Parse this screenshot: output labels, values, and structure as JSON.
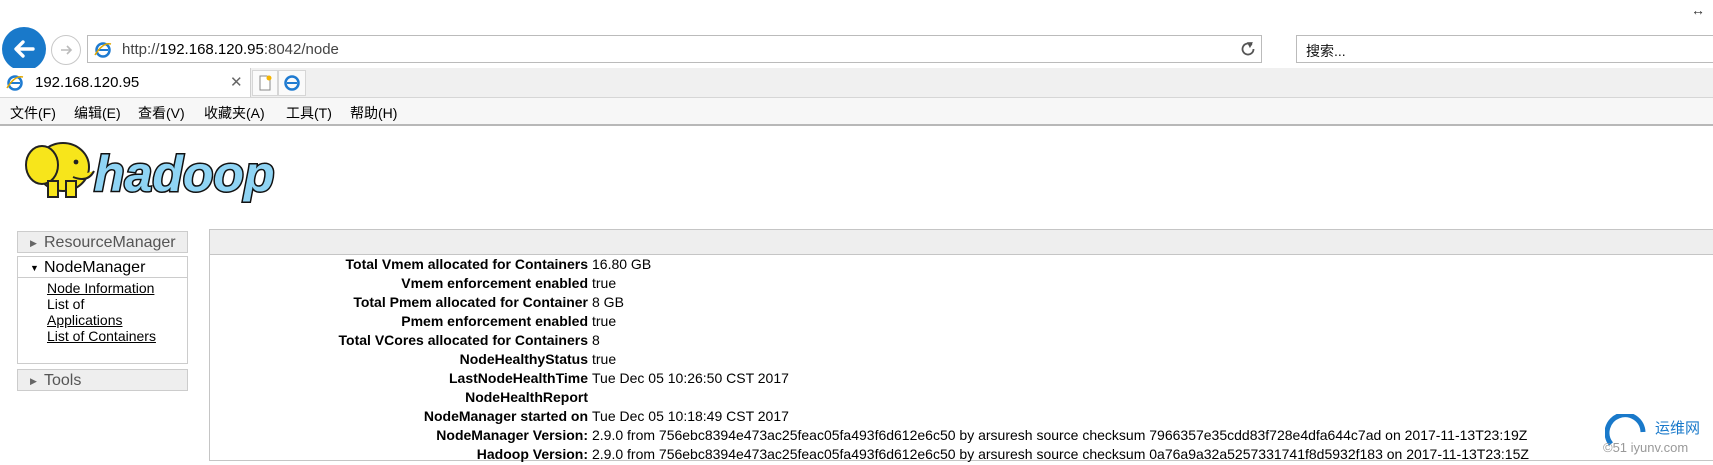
{
  "browser": {
    "url_prefix": "http://",
    "url_host": "192.168.120.95",
    "url_rest": ":8042/node",
    "search_placeholder": "搜索...",
    "tab_title": "192.168.120.95",
    "tab_close": "✕",
    "resize_glyph": "↔"
  },
  "menu": [
    "文件(F)",
    "编辑(E)",
    "查看(V)",
    "收藏夹(A)",
    "工具(T)",
    "帮助(H)"
  ],
  "logo_text": "hadoop",
  "nav": {
    "resource_manager": "ResourceManager",
    "node_manager": "NodeManager",
    "links": [
      "Node Information",
      "List of",
      "Applications",
      "List of Containers"
    ],
    "tools": "Tools"
  },
  "rows": [
    {
      "k": "Total Vmem allocated for Containers",
      "v": "16.80 GB"
    },
    {
      "k": "Vmem enforcement enabled",
      "v": "true"
    },
    {
      "k": "Total Pmem allocated for Container",
      "v": "8 GB"
    },
    {
      "k": "Pmem enforcement enabled",
      "v": "true"
    },
    {
      "k": "Total VCores allocated for Containers",
      "v": "8"
    },
    {
      "k": "NodeHealthyStatus",
      "v": "true"
    },
    {
      "k": "LastNodeHealthTime",
      "v": "Tue Dec 05 10:26:50 CST 2017"
    },
    {
      "k": "NodeHealthReport",
      "v": ""
    },
    {
      "k": "NodeManager started on",
      "v": "Tue Dec 05 10:18:49 CST 2017"
    },
    {
      "k": "NodeManager Version:",
      "v": "2.9.0 from 756ebc8394e473ac25feac05fa493f6d612e6c50 by arsuresh source checksum 7966357e35cdd83f728e4dfa644c7ad on 2017-11-13T23:19Z"
    },
    {
      "k": "Hadoop Version:",
      "v": "2.9.0 from 756ebc8394e473ac25feac05fa493f6d612e6c50 by arsuresh source checksum 0a76a9a32a5257331741f8d5932f183 on 2017-11-13T23:15Z"
    }
  ],
  "watermark": {
    "line1": "运维网",
    "line2": "©51 iyunv.com"
  }
}
